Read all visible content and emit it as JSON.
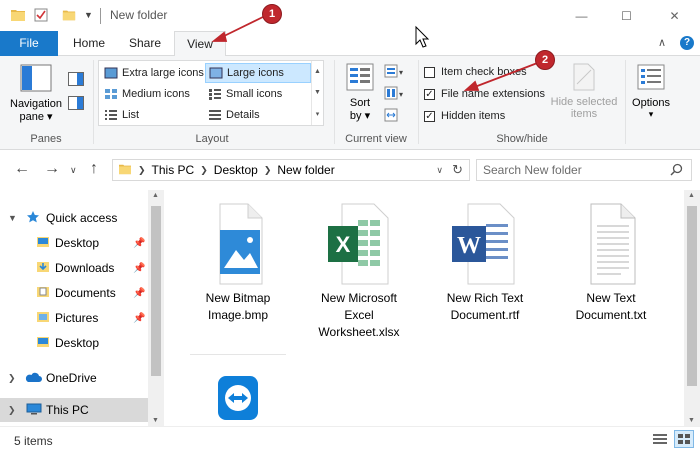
{
  "window": {
    "title": "New folder",
    "minimize_glyph": "—",
    "maximize_glyph": "☐",
    "close_glyph": "✕"
  },
  "tabs": [
    {
      "label": "File"
    },
    {
      "label": "Home"
    },
    {
      "label": "Share"
    },
    {
      "label": "View"
    }
  ],
  "ribbon": {
    "panes": {
      "navigation_pane_line1": "Navigation",
      "navigation_pane_line2": "pane",
      "group_label": "Panes"
    },
    "layout": {
      "group_label": "Layout",
      "items": [
        "Extra large icons",
        "Large icons",
        "Medium icons",
        "Small icons",
        "List",
        "Details"
      ],
      "selected": "Large icons"
    },
    "current_view": {
      "sort_line1": "Sort",
      "sort_line2": "by",
      "group_label": "Current view"
    },
    "show_hide": {
      "group_label": "Show/hide",
      "item_check_boxes": {
        "label": "Item check boxes",
        "checked": false
      },
      "file_name_extensions": {
        "label": "File name extensions",
        "checked": true
      },
      "hidden_items": {
        "label": "Hidden items",
        "checked": true
      },
      "hide_selected_line1": "Hide selected",
      "hide_selected_line2": "items"
    },
    "options": {
      "label": "Options"
    }
  },
  "address": {
    "breadcrumbs": [
      "This PC",
      "Desktop",
      "New folder"
    ],
    "search_placeholder": "Search New folder"
  },
  "nav": {
    "quick_access": "Quick access",
    "items": [
      "Desktop",
      "Downloads",
      "Documents",
      "Pictures",
      "Desktop"
    ],
    "onedrive": "OneDrive",
    "this_pc": "This PC"
  },
  "files": [
    {
      "line1": "New Bitmap",
      "line2": "Image.bmp",
      "line3": "",
      "icon": "bitmap-image-icon"
    },
    {
      "line1": "New Microsoft",
      "line2": "Excel",
      "line3": "Worksheet.xlsx",
      "icon": "excel-icon"
    },
    {
      "line1": "New Rich Text",
      "line2": "Document.rtf",
      "line3": "",
      "icon": "word-icon"
    },
    {
      "line1": "New Text",
      "line2": "Document.txt",
      "line3": "",
      "icon": "text-document-icon"
    }
  ],
  "status": {
    "items_count": "5 items"
  },
  "annotations": {
    "badge1": "1",
    "badge2": "2",
    "color": "#c0272d"
  },
  "colors": {
    "accent": "#1979ca",
    "selection": "#cce8ff",
    "excel_green": "#1d7044",
    "word_blue": "#2b579a"
  }
}
